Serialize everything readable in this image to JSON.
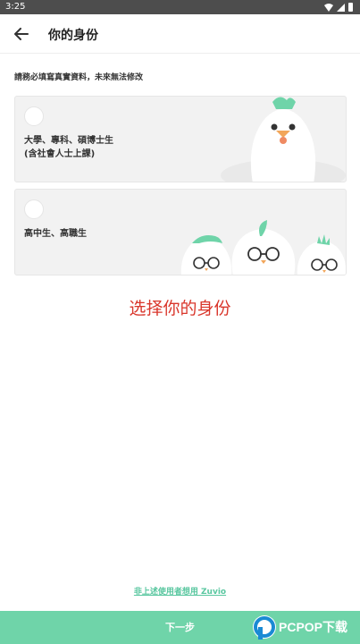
{
  "status_bar": {
    "time": "3:25"
  },
  "header": {
    "title": "你的身份",
    "back_icon": "arrow-left-icon"
  },
  "instruction": "請務必填寫真實資料，未來無法修改",
  "options": [
    {
      "line1": "大學、專科、碩博士生",
      "line2": "(含社會人士上課)"
    },
    {
      "line1": "高中生、高職生",
      "line2": ""
    }
  ],
  "caption": "选择你的身份",
  "footer": {
    "link": "非上述使用者想用 Zuvio",
    "next_button": "下一步"
  },
  "watermark": {
    "brand": "PCPOP下载"
  },
  "colors": {
    "accent": "#6fd4a9",
    "link": "#5ac7a0",
    "caption": "#d9362b",
    "status_bar": "#4d4d4d"
  }
}
